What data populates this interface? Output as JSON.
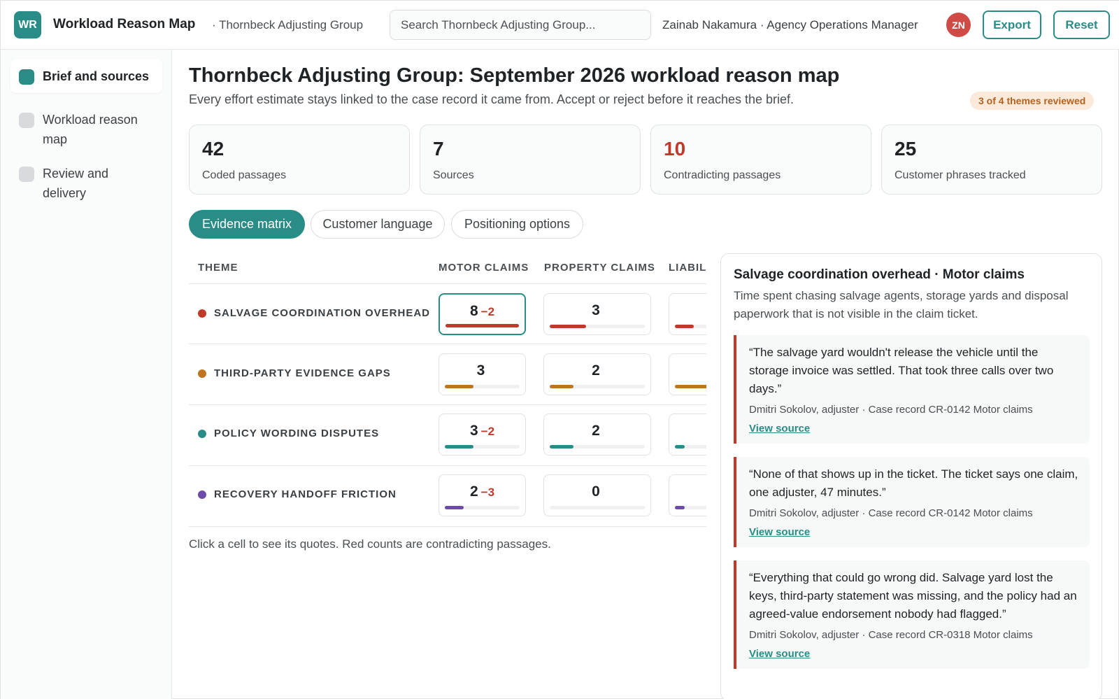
{
  "header": {
    "logo": "WR",
    "app_title": "Workload Reason Map",
    "org": "· Thornbeck Adjusting Group",
    "search_placeholder": "Search Thornbeck Adjusting Group...",
    "user": "Zainab Nakamura · Agency Operations Manager",
    "avatar": "ZN",
    "export_label": "Export",
    "reset_label": "Reset"
  },
  "sidebar": {
    "items": [
      {
        "label": "Brief and sources"
      },
      {
        "label": "Workload reason map"
      },
      {
        "label": "Review and delivery"
      }
    ]
  },
  "main": {
    "title": "Thornbeck Adjusting Group: September 2026 workload reason map",
    "subtitle": "Every effort estimate stays linked to the case record it came from. Accept or reject before it reaches the brief.",
    "review_badge": "3 of 4 themes reviewed",
    "stats": [
      {
        "value": "42",
        "label": "Coded passages"
      },
      {
        "value": "7",
        "label": "Sources"
      },
      {
        "value": "10",
        "label": "Contradicting passages"
      },
      {
        "value": "25",
        "label": "Customer phrases tracked"
      }
    ],
    "tabs": [
      {
        "label": "Evidence matrix"
      },
      {
        "label": "Customer language"
      },
      {
        "label": "Positioning options"
      }
    ],
    "matrix": {
      "headers": [
        "THEME",
        "MOTOR CLAIMS",
        "PROPERTY CLAIMS",
        "LIABILITY CLAIMS"
      ],
      "rows": [
        {
          "theme": "SALVAGE COORDINATION OVERHEAD",
          "color": "#c0392b",
          "cells": [
            {
              "value": "8",
              "neg": "−2",
              "fill": 1.0
            },
            {
              "value": "3",
              "neg": "",
              "fill": 0.38
            },
            {
              "value": "",
              "neg": "",
              "fill": 0.2
            }
          ]
        },
        {
          "theme": "THIRD-PARTY EVIDENCE GAPS",
          "color": "#c0741f",
          "cells": [
            {
              "value": "3",
              "neg": "",
              "fill": 0.38
            },
            {
              "value": "2",
              "neg": "",
              "fill": 0.25
            },
            {
              "value": "",
              "neg": "",
              "fill": 0.9
            }
          ]
        },
        {
          "theme": "POLICY WORDING DISPUTES",
          "color": "#2a8c86",
          "cells": [
            {
              "value": "3",
              "neg": "−2",
              "fill": 0.38
            },
            {
              "value": "2",
              "neg": "",
              "fill": 0.25
            },
            {
              "value": "",
              "neg": "",
              "fill": 0.1
            }
          ]
        },
        {
          "theme": "RECOVERY HANDOFF FRICTION",
          "color": "#6f4aa8",
          "cells": [
            {
              "value": "2",
              "neg": "−3",
              "fill": 0.25
            },
            {
              "value": "0",
              "neg": "",
              "fill": 0
            },
            {
              "value": "",
              "neg": "",
              "fill": 0.1
            }
          ]
        }
      ],
      "note": "Click a cell to see its quotes. Red counts are contradicting passages."
    }
  },
  "panel": {
    "title": "Salvage coordination overhead · Motor claims",
    "description": "Time spent chasing salvage agents, storage yards and disposal paperwork that is not visible in the claim ticket.",
    "quotes": [
      {
        "text": "“The salvage yard wouldn't release the vehicle until the storage invoice was settled. That took three calls over two days.”",
        "meta": "Dmitri Sokolov, adjuster · Case record CR-0142   Motor claims",
        "link": "View source"
      },
      {
        "text": "“None of that shows up in the ticket. The ticket says one claim, one adjuster, 47 minutes.”",
        "meta": "Dmitri Sokolov, adjuster · Case record CR-0142   Motor claims",
        "link": "View source"
      },
      {
        "text": "“Everything that could go wrong did. Salvage yard lost the keys, third-party statement was missing, and the policy had an agreed-value endorsement nobody had flagged.”",
        "meta": "Dmitri Sokolov, adjuster · Case record CR-0318   Motor claims",
        "link": "View source"
      }
    ]
  }
}
